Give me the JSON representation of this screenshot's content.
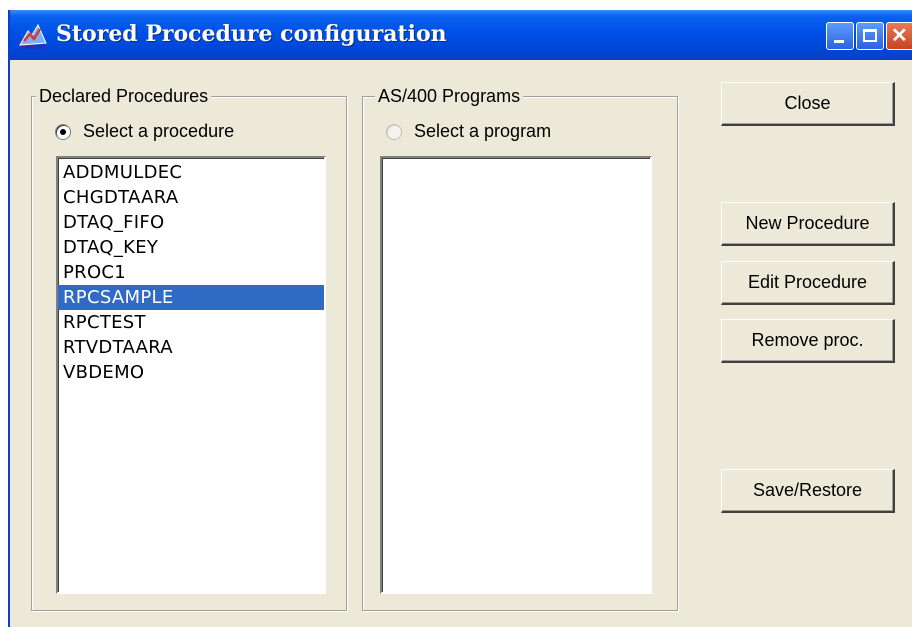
{
  "window": {
    "title": "Stored Procedure configuration",
    "controls": {
      "minimize": "minimize-icon",
      "maximize": "maximize-icon",
      "close": "close-icon"
    }
  },
  "declared": {
    "group_label": "Declared Procedures",
    "radio_label": "Select a procedure",
    "radio_checked": true,
    "items": [
      "ADDMULDEC",
      "CHGDTAARA",
      "DTAQ_FIFO",
      "DTAQ_KEY",
      "PROC1",
      "RPCSAMPLE",
      "RPCTEST",
      "RTVDTAARA",
      "VBDEMO"
    ],
    "selected": "RPCSAMPLE"
  },
  "as400": {
    "group_label": "AS/400 Programs",
    "radio_label": "Select a program",
    "radio_checked": false,
    "items": []
  },
  "buttons": {
    "close": "Close",
    "new_procedure": "New Procedure",
    "edit_procedure": "Edit Procedure",
    "remove_proc": "Remove proc.",
    "save_restore": "Save/Restore"
  },
  "colors": {
    "titlebar": "#0050e6",
    "face": "#ece9d8",
    "selection": "#316ac5",
    "close_button": "#c7441f"
  }
}
